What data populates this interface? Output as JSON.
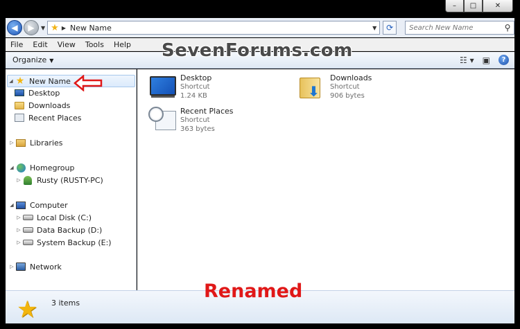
{
  "window": {
    "caption_minimize": "–",
    "caption_maximize": "□",
    "caption_close": "✕"
  },
  "address": {
    "current_path": "New Name",
    "search_placeholder": "Search New Name"
  },
  "menu": {
    "file": "File",
    "edit": "Edit",
    "view": "View",
    "tools": "Tools",
    "help": "Help"
  },
  "toolbar": {
    "organize": "Organize"
  },
  "watermark": "SevenForums.com",
  "nav_tree": {
    "favorites": {
      "label": "New Name",
      "icon": "star-icon"
    },
    "desktop": {
      "label": "Desktop",
      "icon": "desktop-icon"
    },
    "downloads": {
      "label": "Downloads",
      "icon": "downloads-folder-icon"
    },
    "recent": {
      "label": "Recent Places",
      "icon": "recent-places-icon"
    },
    "libraries": {
      "label": "Libraries",
      "icon": "libraries-icon"
    },
    "homegroup": {
      "label": "Homegroup",
      "icon": "homegroup-icon"
    },
    "rusty": {
      "label": "Rusty (RUSTY-PC)",
      "icon": "user-icon"
    },
    "computer": {
      "label": "Computer",
      "icon": "computer-icon"
    },
    "local_disk": {
      "label": "Local Disk (C:)",
      "icon": "disk-icon"
    },
    "data_backup": {
      "label": "Data Backup (D:)",
      "icon": "disk-icon"
    },
    "system_backup": {
      "label": "System Backup (E:)",
      "icon": "disk-icon"
    },
    "network": {
      "label": "Network",
      "icon": "network-icon"
    }
  },
  "items": [
    {
      "name": "Desktop",
      "type": "Shortcut",
      "size": "1.24 KB",
      "icon": "desktop-icon"
    },
    {
      "name": "Downloads",
      "type": "Shortcut",
      "size": "906 bytes",
      "icon": "downloads-folder-icon"
    },
    {
      "name": "Recent Places",
      "type": "Shortcut",
      "size": "363 bytes",
      "icon": "recent-places-icon"
    }
  ],
  "details": {
    "count": "3 items"
  },
  "annotation": {
    "label": "Renamed",
    "color": "#e01818"
  },
  "colors": {
    "selection": "#dbeafc",
    "accent": "#1e56b8"
  }
}
